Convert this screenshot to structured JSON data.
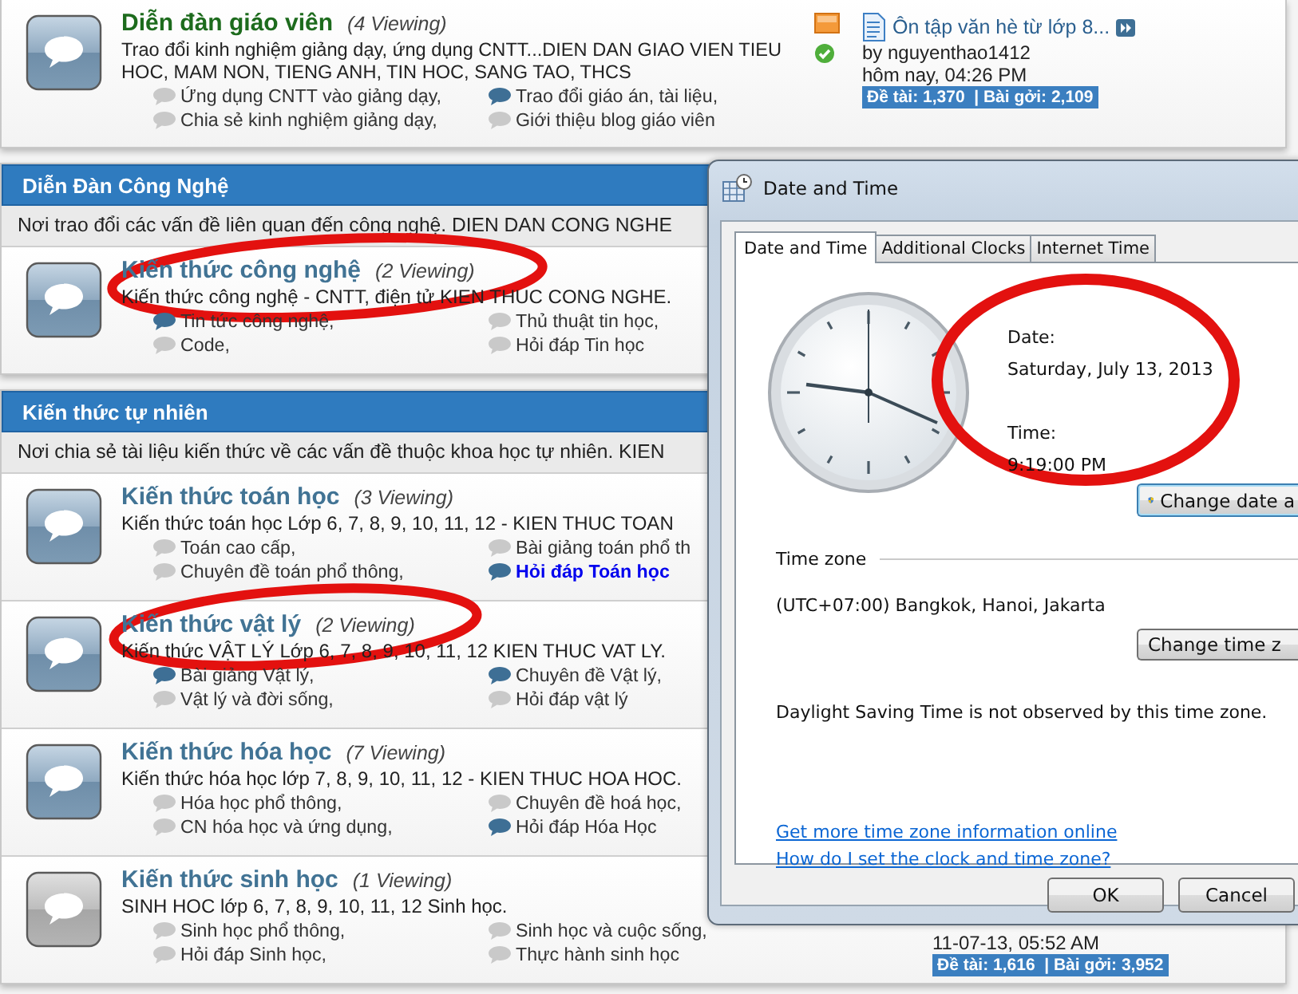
{
  "top_forum": {
    "featured": true,
    "new": true,
    "title": "Diễn đàn giáo viên",
    "viewing": "(4 Viewing)",
    "description": "Trao đổi kinh nghiệm giảng dạy, ứng dụng CNTT...DIEN DAN GIAO VIEN TIEU HOC, MAM NON, TIENG ANH, TIN HOC, SANG TAO, THCS",
    "subforums": [
      {
        "label": "Ứng dụng CNTT vào giảng dạy,",
        "new": false,
        "emphasized": false
      },
      {
        "label": "Trao đổi giáo án, tài liệu,",
        "new": true,
        "emphasized": false
      },
      {
        "label": "Chia sẻ kinh nghiệm giảng dạy,",
        "new": false,
        "emphasized": false
      },
      {
        "label": "Giới thiệu blog giáo viên",
        "new": false,
        "emphasized": false
      }
    ],
    "last_post": {
      "title": "Ôn tập văn hè từ lớp 8...",
      "by": "by nguyenthao1412",
      "time": "hôm nay, 04:26 PM",
      "stats": "Đề tài: 1,370  | Bài gởi: 2,109"
    }
  },
  "sections": [
    {
      "title": "Diễn Đàn Công Nghệ",
      "description": "Nơi trao đổi các vấn đề liên quan đến công nghệ. DIEN DAN CONG NGHE",
      "forums": [
        {
          "featured": false,
          "new": true,
          "title": "Kiến thức công nghệ",
          "viewing": "(2 Viewing)",
          "description": "Kiến thức công nghệ - CNTT, điện tử KIEN THUC CONG NGHE.",
          "subforums": [
            {
              "label": "Tin tức công nghệ,",
              "new": true,
              "emphasized": false
            },
            {
              "label": "Thủ thuật tin học,",
              "new": false,
              "emphasized": false
            },
            {
              "label": "Code,",
              "new": false,
              "emphasized": false
            },
            {
              "label": "Hỏi đáp Tin học",
              "new": false,
              "emphasized": false
            }
          ]
        }
      ]
    },
    {
      "title": "Kiến thức tự nhiên",
      "description": "Nơi chia sẻ tài liệu kiến thức về các vấn đề thuộc khoa học tự nhiên. KIEN",
      "forums": [
        {
          "featured": false,
          "new": true,
          "title": "Kiến thức toán học",
          "viewing": "(3 Viewing)",
          "description": "Kiến thức toán học Lớp 6, 7, 8, 9, 10, 11, 12 - KIEN THUC TOAN",
          "subforums": [
            {
              "label": "Toán cao cấp,",
              "new": false,
              "emphasized": false
            },
            {
              "label": "Bài giảng toán phổ th",
              "new": false,
              "emphasized": false
            },
            {
              "label": "Chuyên đề toán phổ thông,",
              "new": false,
              "emphasized": false
            },
            {
              "label": "Hỏi đáp Toán học",
              "new": true,
              "emphasized": true
            }
          ]
        },
        {
          "featured": false,
          "new": true,
          "title": "Kiến thức vật lý",
          "viewing": "(2 Viewing)",
          "description": "Kiến thức VẬT LÝ Lớp 6, 7, 8, 9, 10, 11, 12 KIEN THUC VAT LY.",
          "subforums": [
            {
              "label": "Bài giảng Vật lý,",
              "new": true,
              "emphasized": false
            },
            {
              "label": "Chuyên đề Vật lý,",
              "new": true,
              "emphasized": false
            },
            {
              "label": "Vật lý và đời sống,",
              "new": false,
              "emphasized": false
            },
            {
              "label": "Hỏi đáp vật lý",
              "new": false,
              "emphasized": false
            }
          ]
        },
        {
          "featured": false,
          "new": true,
          "title": "Kiến thức hóa học",
          "viewing": "(7 Viewing)",
          "description": "Kiến thức hóa học lớp 7, 8, 9, 10, 11, 12 - KIEN THUC HOA HOC.",
          "subforums": [
            {
              "label": "Hóa học phổ thông,",
              "new": false,
              "emphasized": false
            },
            {
              "label": "Chuyên đề hoá học,",
              "new": false,
              "emphasized": false
            },
            {
              "label": "CN hóa học và ứng dụng,",
              "new": false,
              "emphasized": false
            },
            {
              "label": "Hỏi đáp Hóa Học",
              "new": true,
              "emphasized": false
            }
          ]
        },
        {
          "featured": false,
          "new": false,
          "title": "Kiến thức sinh học",
          "viewing": "(1 Viewing)",
          "description": "SINH HOC lớp 6, 7, 8, 9, 10, 11, 12 Sinh học.",
          "subforums": [
            {
              "label": "Sinh học phổ thông,",
              "new": false,
              "emphasized": false
            },
            {
              "label": "Sinh học và cuộc sống,",
              "new": false,
              "emphasized": false
            },
            {
              "label": "Hỏi đáp Sinh học,",
              "new": false,
              "emphasized": false
            },
            {
              "label": "Thực hành sinh học",
              "new": false,
              "emphasized": false
            }
          ],
          "last_post": {
            "time": "11-07-13, 05:52 AM",
            "stats": "Đề tài: 1,616  | Bài gởi: 3,952"
          }
        }
      ]
    }
  ],
  "dialog": {
    "title": "Date and Time",
    "tabs": [
      {
        "label": "Date and Time",
        "selected": true
      },
      {
        "label": "Additional Clocks",
        "selected": false
      },
      {
        "label": "Internet Time",
        "selected": false
      }
    ],
    "date_label": "Date:",
    "date": "Saturday, July 13, 2013",
    "time_label": "Time:",
    "time": "9:19:00 PM",
    "change_datetime_button": "Change date a",
    "timezone_heading": "Time zone",
    "timezone": "(UTC+07:00) Bangkok, Hanoi, Jakarta",
    "change_timezone_button": "Change time z",
    "dst_note": "Daylight Saving Time is not observed by this time zone.",
    "links": [
      "Get more time zone information online",
      "How do I set the clock and time zone?"
    ],
    "buttons": [
      "OK",
      "Cancel"
    ]
  }
}
